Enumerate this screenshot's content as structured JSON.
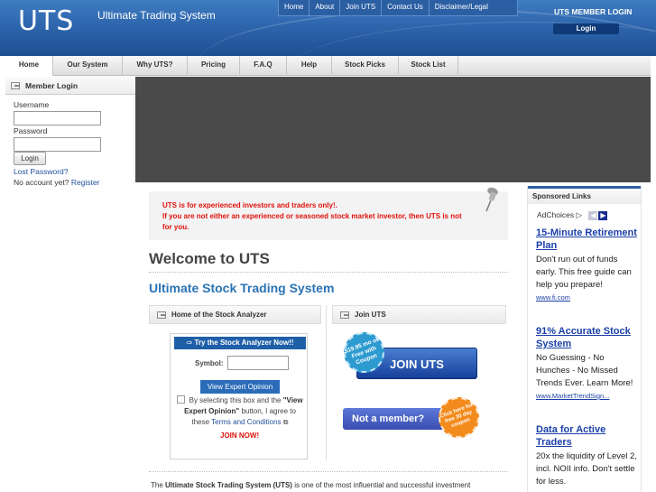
{
  "header": {
    "logo": "UTS",
    "tagline": "Ultimate Trading System",
    "top_nav": [
      "Home",
      "About",
      "Join UTS",
      "Contact Us",
      "Disclaimer/Legal"
    ],
    "member_login_title": "UTS MEMBER LOGIN",
    "login_button": "Login"
  },
  "main_nav": {
    "tabs": [
      "Home",
      "Our System",
      "Why UTS?",
      "Pricing",
      "F.A.Q",
      "Help",
      "Stock Picks",
      "Stock List"
    ],
    "active": "Home"
  },
  "sidebar": {
    "title": "Member Login",
    "username_label": "Username",
    "password_label": "Password",
    "login_button": "Login",
    "lost_password": "Lost Password?",
    "no_account": "No account yet?",
    "register": "Register"
  },
  "alert": {
    "line1": "UTS is for experienced investors and traders only!.",
    "line2": "If you are not either an experienced or seasoned stock market investor, then UTS is not for you."
  },
  "content": {
    "welcome": "Welcome to UTS",
    "subtitle": "Ultimate Stock Trading System",
    "panel_left_title": "Home of the Stock Analyzer",
    "panel_right_title": "Join UTS",
    "bottom_text_prefix": "The",
    "bottom_text_bold": "Ultimate Stock Trading System (UTS)",
    "bottom_text_suffix": "is one of the most influential and successful investment"
  },
  "analyzer": {
    "header": "Try the Stock Analyzer Now!!",
    "symbol_label": "Symbol:",
    "expert_button": "View Expert Opinion",
    "agree_prefix": "By selecting this box and the",
    "agree_bold": "\"View Expert Opinion\"",
    "agree_middle": "button, I agree to these",
    "terms_link": "Terms and Conditions",
    "join_now": "JOIN NOW!"
  },
  "join": {
    "join_button": "JOIN UTS",
    "seal1": "$19.95 mo or Free with Coupon",
    "member_button": "Not a member?",
    "seal2": "Click here for free 30 day coupon"
  },
  "ads": {
    "title": "Sponsored Links",
    "adchoices": "AdChoices",
    "items": [
      {
        "headline": "15-Minute Retirement Plan",
        "desc": "Don't run out of funds early. This free guide can help you prepare!",
        "url": "www.fi.com"
      },
      {
        "headline": "91% Accurate Stock System",
        "desc": "No Guessing - No Hunches - No Missed Trends Ever. Learn More!",
        "url": "www.MarketTrendSign..."
      },
      {
        "headline": "Data for Active Traders",
        "desc": "20x the liquidity of Level 2, incl. NOII info. Don't settle for less.",
        "url": ""
      }
    ]
  }
}
